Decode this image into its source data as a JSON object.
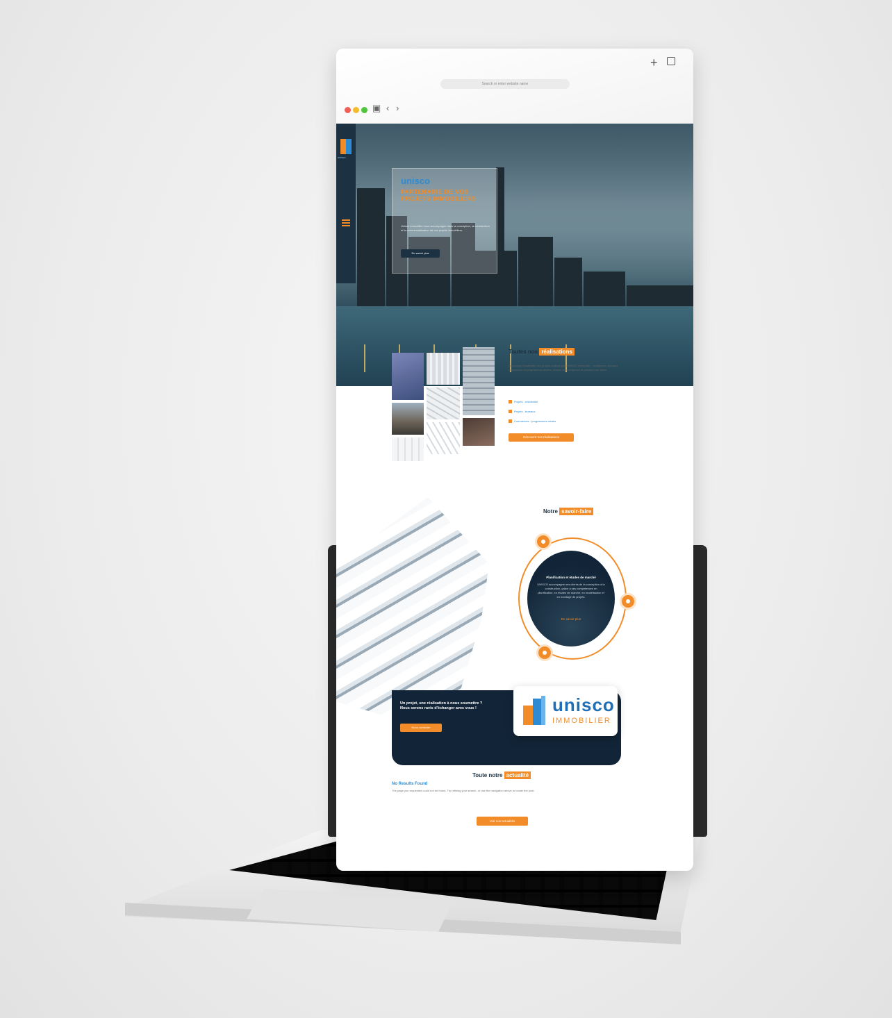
{
  "browser": {
    "url_placeholder": "Search or enter website name",
    "nav_back": "‹",
    "nav_forward": "›",
    "new_tab": "+"
  },
  "sidebar": {
    "logo_text": "unisco"
  },
  "hero": {
    "brand": "unisco",
    "title": "PARTENAIRE DE VOS PROJETS IMMOBILIERS",
    "description": "Unisco Immobilier vous accompagne dans la conception, la construction et la commercialisation de vos projets immobiliers.",
    "button_label": "En savoir plus"
  },
  "realisations": {
    "title_prefix": "Toutes nos",
    "title_highlight": "réalisations",
    "description": "Découvrez l'ensemble des projets réalisés par UNISCO Immobilier : résidences, bureaux, commerces et programmes mixtes, conçus avec exigence et pensés pour durer.",
    "bullets": [
      "Projets - résidentiel",
      "Projets - bureaux",
      "Commerces - programmes mixtes"
    ],
    "button_label": "Découvrir nos réalisations"
  },
  "savoir_faire": {
    "title_prefix": "Notre",
    "title_highlight": "savoir-faire",
    "card_title": "Planification et études de marché",
    "card_description": "UNISCO accompagne ses clients de la conception à la construction, grâce à ses compétences en planification, en études de marché, en modélisation et en montage de projets.",
    "card_link": "En savoir plus"
  },
  "cta": {
    "text": "Un projet, une réalisation à nous soumettre ? Nous serons ravis d'échanger avec vous !",
    "button_label": "Nous contacter"
  },
  "logo": {
    "name": "unisco",
    "sub": "IMMOBILIER"
  },
  "actualites": {
    "title_prefix": "Toute notre",
    "title_highlight": "actualité",
    "no_results": "No Results Found",
    "no_results_desc": "The page you requested could not be found. Try refining your search, or use the navigation above to locate the post.",
    "button_label": "Voir nos actualités"
  },
  "colors": {
    "accent": "#f28c28",
    "brand_blue": "#2d8bd3",
    "navy": "#122538"
  }
}
